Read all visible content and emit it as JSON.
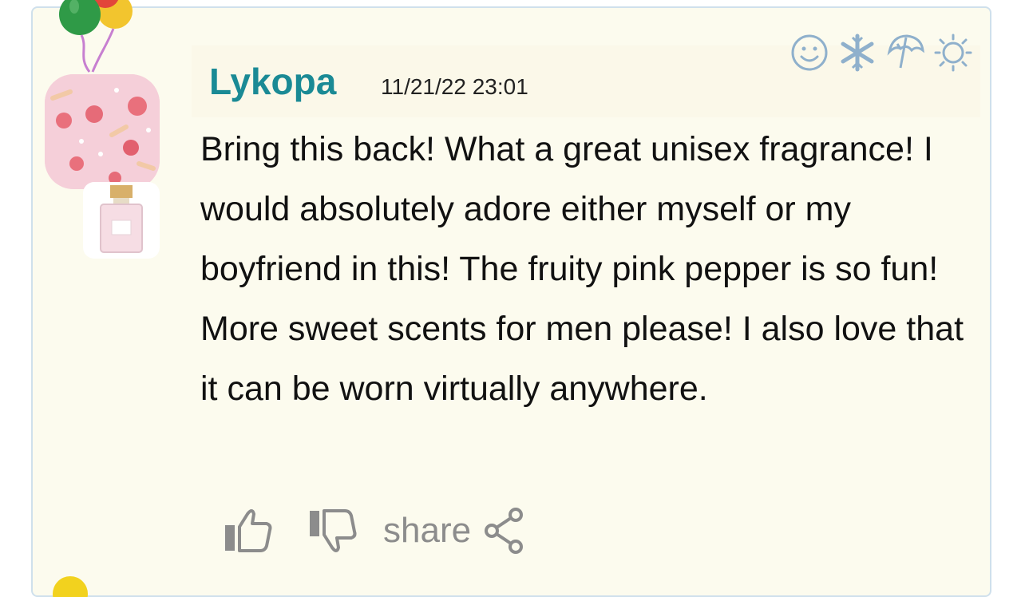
{
  "comment": {
    "username": "Lykopa",
    "timestamp": "11/21/22 23:01",
    "text": "Bring this back! What a great unisex fragrance! I would absolutely adore either myself or my boyfriend in this! The fruity pink pepper is so fun! More sweet scents for men please! I also love that it can be worn virtually anywhere."
  },
  "season_icons": [
    "smiley-icon",
    "snowflake-icon",
    "umbrella-icon",
    "sun-icon"
  ],
  "actions": {
    "share_label": "share",
    "icons": [
      "thumbs-up-icon",
      "thumbs-down-icon",
      "share-icon"
    ]
  },
  "colors": {
    "card_bg": "#fcfbee",
    "card_border": "#cfe0ec",
    "username": "#1a8a95",
    "icon_blue": "#8fb0cc",
    "action_gray": "#8c8c8c"
  }
}
